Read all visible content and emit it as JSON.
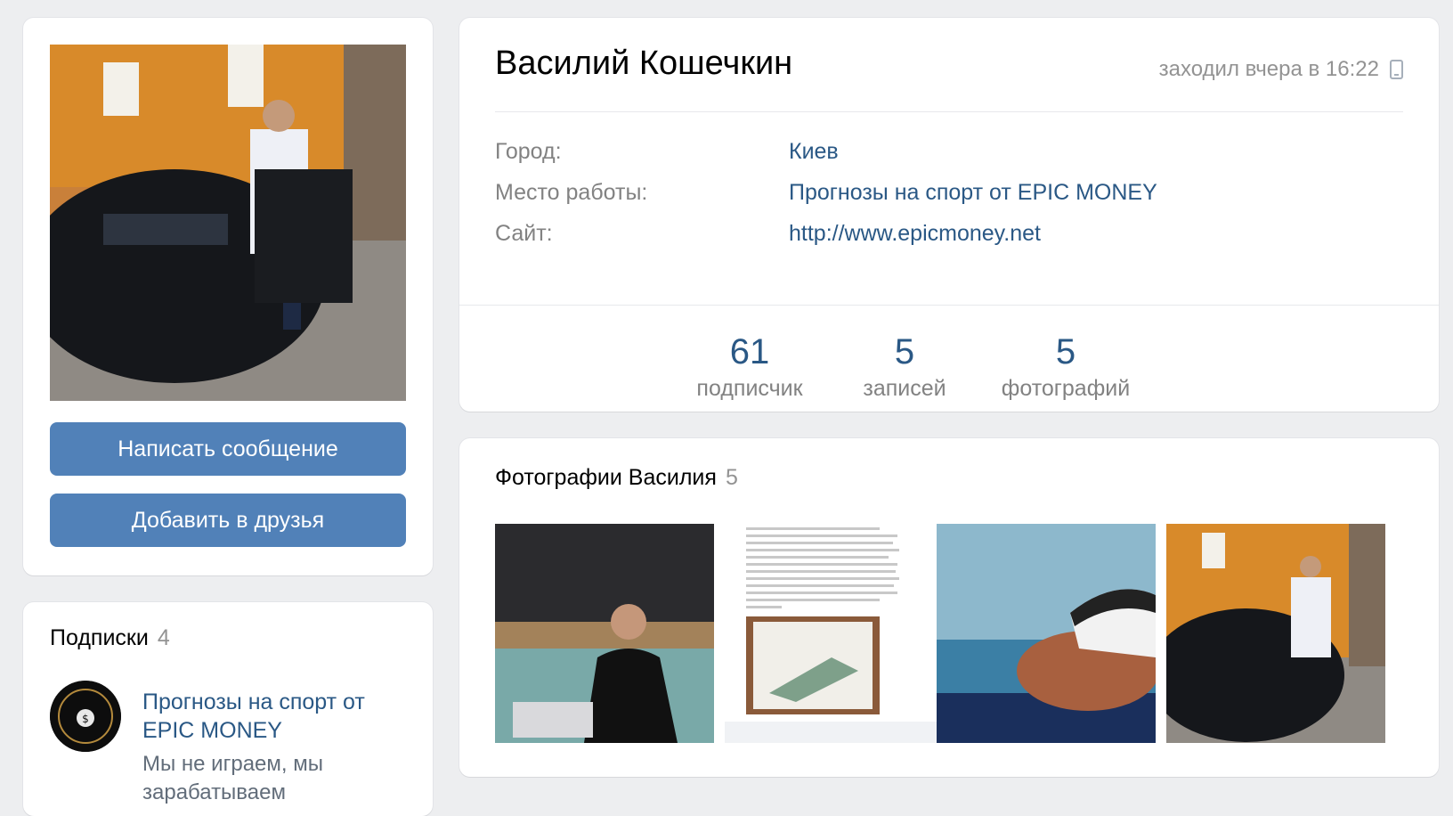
{
  "profile": {
    "name": "Василий Кошечкин",
    "online_status": "заходил вчера в 16:22",
    "info": [
      {
        "label": "Город:",
        "value": "Киев"
      },
      {
        "label": "Место работы:",
        "value": "Прогнозы на спорт от EPIC MONEY"
      },
      {
        "label": "Сайт:",
        "value": "http://www.epicmoney.net"
      }
    ],
    "counters": [
      {
        "value": "61",
        "label": "подписчик"
      },
      {
        "value": "5",
        "label": "записей"
      },
      {
        "value": "5",
        "label": "фотографий"
      }
    ]
  },
  "actions": {
    "message_label": "Написать сообщение",
    "add_friend_label": "Добавить в друзья"
  },
  "subscriptions": {
    "title": "Подписки",
    "count": "4",
    "items": [
      {
        "name": "Прогнозы на спорт от EPIC MONEY",
        "description": "Мы не играем, мы зарабатываем"
      }
    ]
  },
  "photos": {
    "title": "Фотографии Василия",
    "count": "5"
  },
  "colors": {
    "link": "#2a5885",
    "button": "#5181b8",
    "background": "#edeef0"
  }
}
